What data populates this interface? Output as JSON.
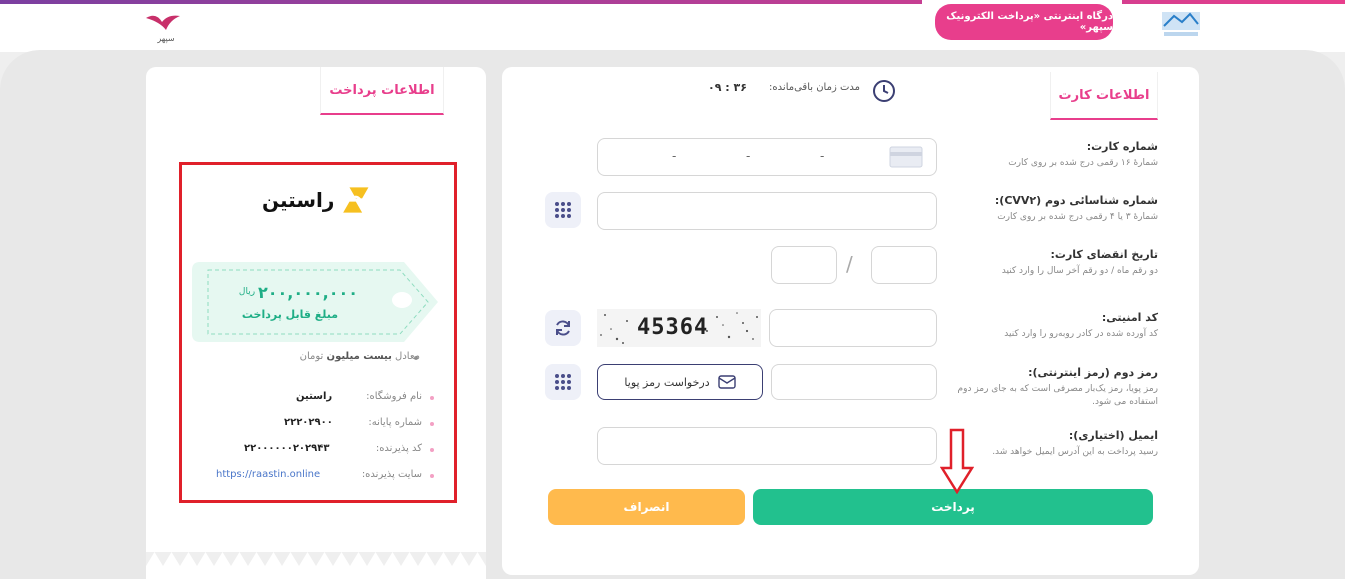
{
  "header": {
    "gateway_title": "درگاه اینترنتی «پرداخت الکترونیک سپهر»",
    "logo_left_text": "سپهر"
  },
  "payment_info": {
    "tab_label": "اطلاعات پرداخت",
    "merchant_brand": "راستین",
    "amount": "۲۰۰,۰۰۰,۰۰۰",
    "currency": "ریال",
    "amount_label": "مبلغ قابل پرداخت",
    "equivalent_prefix": "معادل",
    "equivalent_amount": "بیست میلیون",
    "equivalent_unit": "تومان",
    "details": [
      {
        "key": "نام فروشگاه:",
        "value": "راستین"
      },
      {
        "key": "شماره پایانه:",
        "value": "۲۲۲۰۲۹۰۰"
      },
      {
        "key": "کد پذیرنده:",
        "value": "۲۲۰۰۰۰۰۰۲۰۲۹۴۳"
      },
      {
        "key": "سایت پذیرنده:",
        "value": "https://raastin.online"
      }
    ]
  },
  "card_info": {
    "tab_label": "اطلاعات کارت",
    "timer_label": "مدت زمان باقی‌مانده:",
    "timer_value": "۰۹ : ۳۶",
    "fields": {
      "card_number": {
        "label": "شماره کارت:",
        "hint": "شمارهٔ ۱۶ رقمی درج شده بر روی کارت"
      },
      "cvv2": {
        "label": "شماره شناسائی دوم (CVV۲):",
        "hint": "شمارهٔ ۳ یا ۴ رقمی درج شده بر روی کارت"
      },
      "expiry": {
        "label": "تاریخ انقضای کارت:",
        "hint": "دو رقم ماه / دو رقم آخر سال را وارد کنید"
      },
      "captcha": {
        "label": "کد امنیتی:",
        "hint": "کد آورده شده در کادر روبه‌رو را وارد کنید",
        "captcha_text": "45364"
      },
      "pin2": {
        "label": "رمز دوم (رمز اینترنتی):",
        "hint": "رمز پویا، رمز یک‌بار مصرفی است که به جای رمز دوم استفاده می شود.",
        "otp_button": "درخواست رمز پویا"
      },
      "email": {
        "label": "ایمیل (اختیاری):",
        "hint": "رسید پرداخت به این آدرس ایمیل خواهد شد."
      }
    },
    "pay_button": "پرداخت",
    "cancel_button": "انصراف"
  },
  "colors": {
    "accent": "#e83e8c",
    "pay": "#22c18e",
    "cancel": "#ffba4d",
    "highlight": "#e0202a"
  }
}
